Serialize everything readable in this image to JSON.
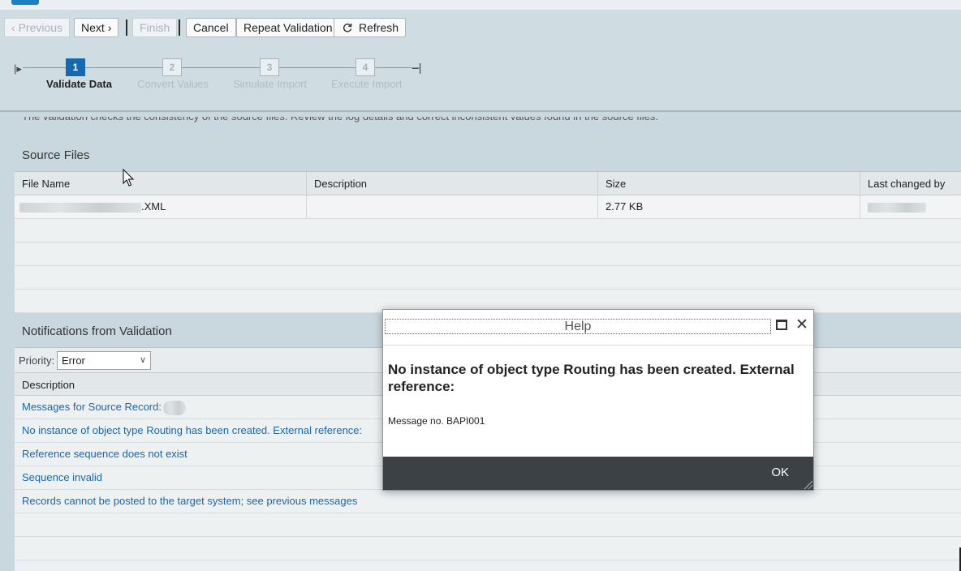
{
  "toolbar": {
    "previous_label": "Previous",
    "next_label": "Next",
    "finish_label": "Finish",
    "cancel_label": "Cancel",
    "repeat_label": "Repeat Validation",
    "refresh_label": "Refresh"
  },
  "roadmap": {
    "steps": [
      {
        "number": "1",
        "label": "Validate Data",
        "active": true
      },
      {
        "number": "2",
        "label": "Convert Values",
        "active": false
      },
      {
        "number": "3",
        "label": "Simulate Import",
        "active": false
      },
      {
        "number": "4",
        "label": "Execute Import",
        "active": false
      }
    ]
  },
  "intro_text": "The validation checks the consistency of the source files. Review the log details and correct inconsistent values found in the source files.",
  "source_files": {
    "title": "Source Files",
    "columns": [
      "File Name",
      "Description",
      "Size",
      "Last changed by"
    ],
    "rows": [
      {
        "file_name_suffix": ".XML",
        "description": "",
        "size": "2.77 KB"
      }
    ]
  },
  "notifications": {
    "title": "Notifications from Validation",
    "priority_label": "Priority:",
    "priority_value": "Error",
    "column": "Description",
    "rows": [
      "Messages for Source Record:",
      "No instance of object type Routing has been created. External reference:",
      "Reference sequence does not exist",
      "Sequence invalid",
      "Records cannot be posted to the target system; see previous messages"
    ]
  },
  "dialog": {
    "title": "Help",
    "message": "No instance of object type Routing has been created. External reference:",
    "message_no": "Message no. BAPI001",
    "ok_label": "OK"
  }
}
